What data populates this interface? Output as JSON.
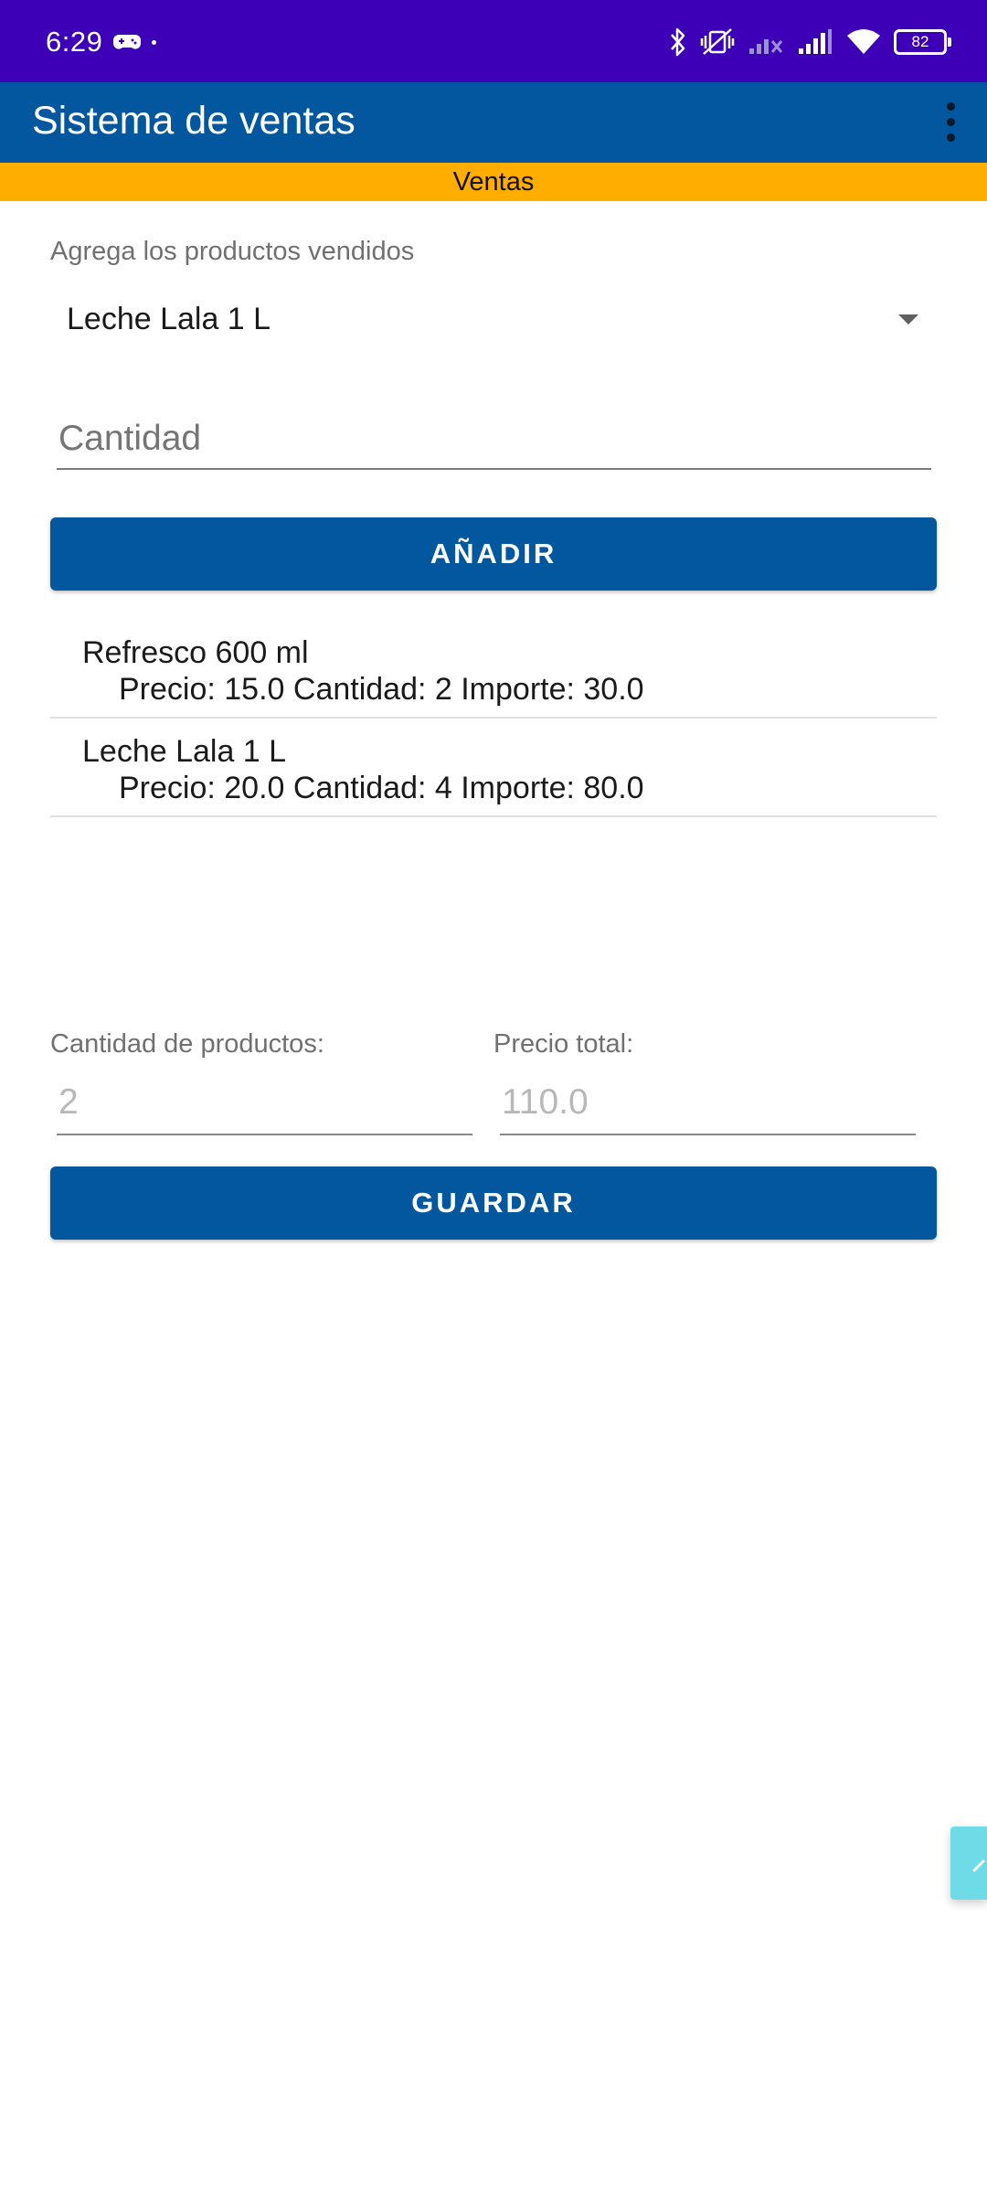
{
  "status_bar": {
    "time": "6:29",
    "battery": "82",
    "icons": [
      "gamepad-icon",
      "bluetooth-icon",
      "vibrate-off-icon",
      "signal-no-service-icon",
      "signal-icon",
      "wifi-icon",
      "battery-icon"
    ]
  },
  "app_bar": {
    "title": "Sistema de ventas",
    "overflow_icon": "more-vert-icon"
  },
  "tab": {
    "label": "Ventas"
  },
  "form": {
    "prompt": "Agrega los productos vendidos",
    "product_selected": "Leche Lala 1 L",
    "quantity_placeholder": "Cantidad",
    "quantity_value": "",
    "add_label": "AÑADIR"
  },
  "items": [
    {
      "name": "Refresco 600 ml",
      "detail": "Precio: 15.0 Cantidad: 2 Importe: 30.0"
    },
    {
      "name": "Leche Lala 1 L",
      "detail": "Precio: 20.0 Cantidad: 4 Importe: 80.0"
    }
  ],
  "totals": {
    "count_label": "Cantidad de productos:",
    "count_value": "2",
    "price_label": "Precio total:",
    "price_value": "110.0"
  },
  "save_label": "GUARDAR",
  "colors": {
    "status_bar": "#3d00b7",
    "primary": "#02579e",
    "tab_strip": "#ffae00",
    "edge_tab": "#6fdbe6"
  }
}
